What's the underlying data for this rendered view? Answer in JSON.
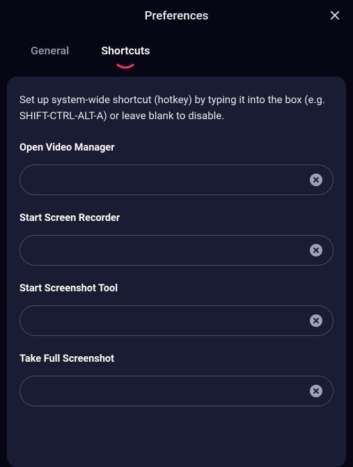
{
  "header": {
    "title": "Preferences"
  },
  "tabs": {
    "general": "General",
    "shortcuts": "Shortcuts"
  },
  "panel": {
    "description": "Set up system-wide shortcut (hotkey) by typing it into the box (e.g. SHIFT-CTRL-ALT-A) or leave blank to disable.",
    "fields": [
      {
        "label": "Open Video Manager",
        "value": ""
      },
      {
        "label": "Start Screen Recorder",
        "value": ""
      },
      {
        "label": "Start Screenshot Tool",
        "value": ""
      },
      {
        "label": "Take Full Screenshot",
        "value": ""
      }
    ]
  }
}
